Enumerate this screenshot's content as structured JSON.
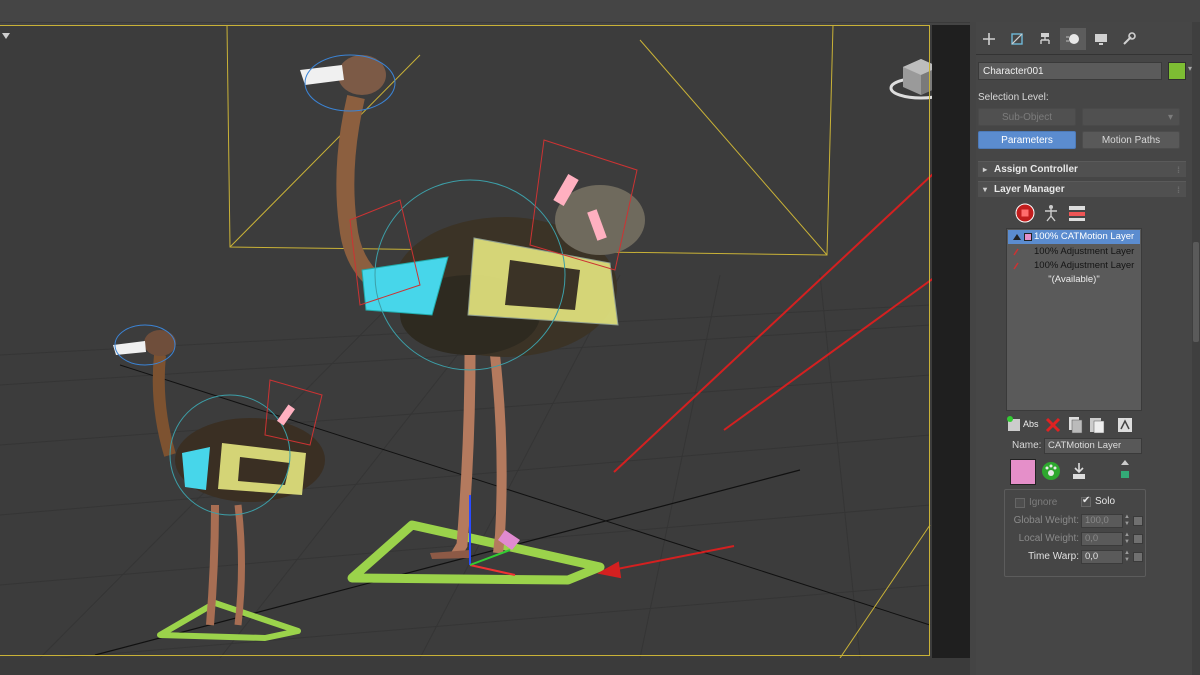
{
  "panel": {
    "tabs": [
      "create-icon",
      "modify-icon",
      "hierarchy-icon",
      "motion-icon",
      "display-icon",
      "utilities-icon"
    ],
    "object_name": "Character001",
    "object_color": "#7dbd33",
    "selection_level_label": "Selection Level:",
    "sub_object_label": "Sub-Object",
    "parameters_label": "Parameters",
    "motion_paths_label": "Motion Paths",
    "rollouts": {
      "assign_controller": "Assign Controller",
      "layer_manager": "Layer Manager"
    },
    "layers": [
      {
        "label": "100% CATMotion Layer",
        "selected": true
      },
      {
        "label": "100% Adjustment Layer",
        "selected": false
      },
      {
        "label": "100% Adjustment Layer",
        "selected": false
      }
    ],
    "available_label": "\"(Available)\"",
    "abs_label": "Abs",
    "name_label": "Name:",
    "name_value": "CATMotion Layer",
    "layer_color": "#e58fc9",
    "ignore_label": "Ignore",
    "ignore_checked": false,
    "solo_label": "Solo",
    "solo_checked": true,
    "global_weight_label": "Global Weight:",
    "global_weight_value": "100,0",
    "local_weight_label": "Local Weight:",
    "local_weight_value": "0,0",
    "time_warp_label": "Time Warp:",
    "time_warp_value": "0,0"
  },
  "annotations": {
    "arrow_color": "#d42020",
    "arrow_count": 4
  }
}
